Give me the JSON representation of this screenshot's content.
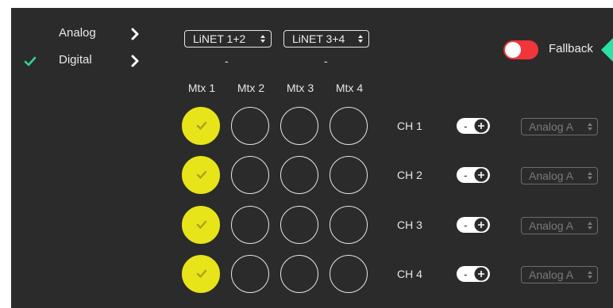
{
  "sidebar": {
    "items": [
      {
        "label": "Analog",
        "selected": false
      },
      {
        "label": "Digital",
        "selected": true
      }
    ]
  },
  "header": {
    "net_selects": [
      {
        "label": "LiNET 1+2",
        "value": "-"
      },
      {
        "label": "LiNET 3+4",
        "value": "-"
      }
    ],
    "fallback": {
      "label": "Fallback",
      "enabled": false
    }
  },
  "matrix": {
    "columns": [
      "Mtx 1",
      "Mtx 2",
      "Mtx 3",
      "Mtx 4"
    ],
    "rows": [
      {
        "channel": "CH 1",
        "active": [
          true,
          false,
          false,
          false
        ],
        "source": "Analog A"
      },
      {
        "channel": "CH 2",
        "active": [
          true,
          false,
          false,
          false
        ],
        "source": "Analog A"
      },
      {
        "channel": "CH 3",
        "active": [
          true,
          false,
          false,
          false
        ],
        "source": "Analog A"
      },
      {
        "channel": "CH 4",
        "active": [
          true,
          false,
          false,
          false
        ],
        "source": "Analog A"
      }
    ],
    "stepper": {
      "minus": "-",
      "plus": "+"
    }
  },
  "colors": {
    "background": "#2b2b2b",
    "active_cell": "#e8e41a",
    "check_green": "#2ed890",
    "toggle_red": "#f0353b",
    "marker_teal": "#2ee0a6"
  }
}
